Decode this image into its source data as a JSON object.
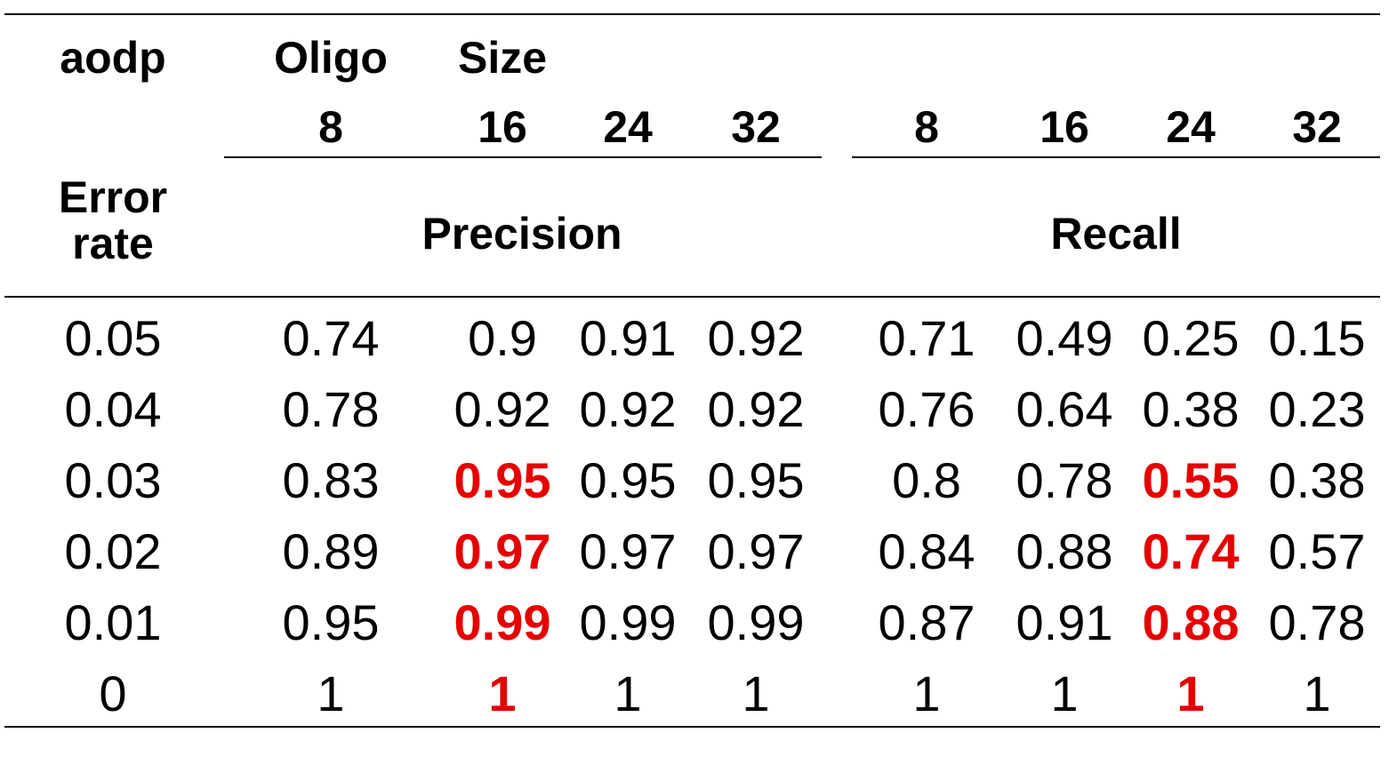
{
  "table": {
    "corner_label": "aodp",
    "oligo_label": "Oligo",
    "size_label": "Size",
    "error_rate_label": [
      "Error",
      "rate"
    ],
    "precision_label": "Precision",
    "recall_label": "Recall",
    "oligo_sizes": [
      "8",
      "16",
      "24",
      "32",
      "8",
      "16",
      "24",
      "32"
    ],
    "highlight_color": "#e60000",
    "rows": [
      {
        "error_rate": "0.05",
        "values": [
          "0.74",
          "0.9",
          "0.91",
          "0.92",
          "0.71",
          "0.49",
          "0.25",
          "0.15"
        ]
      },
      {
        "error_rate": "0.04",
        "values": [
          "0.78",
          "0.92",
          "0.92",
          "0.92",
          "0.76",
          "0.64",
          "0.38",
          "0.23"
        ]
      },
      {
        "error_rate": "0.03",
        "values": [
          "0.83",
          "0.95",
          "0.95",
          "0.95",
          "0.8",
          "0.78",
          "0.55",
          "0.38"
        ]
      },
      {
        "error_rate": "0.02",
        "values": [
          "0.89",
          "0.97",
          "0.97",
          "0.97",
          "0.84",
          "0.88",
          "0.74",
          "0.57"
        ]
      },
      {
        "error_rate": "0.01",
        "values": [
          "0.95",
          "0.99",
          "0.99",
          "0.99",
          "0.87",
          "0.91",
          "0.88",
          "0.78"
        ]
      },
      {
        "error_rate": "0",
        "values": [
          "1",
          "1",
          "1",
          "1",
          "1",
          "1",
          "1",
          "1"
        ]
      }
    ],
    "highlighted_cells": [
      [
        2,
        1
      ],
      [
        2,
        5
      ],
      [
        3,
        1
      ],
      [
        3,
        5
      ],
      [
        4,
        1
      ],
      [
        4,
        5
      ],
      [
        5,
        1
      ],
      [
        5,
        5
      ]
    ]
  }
}
